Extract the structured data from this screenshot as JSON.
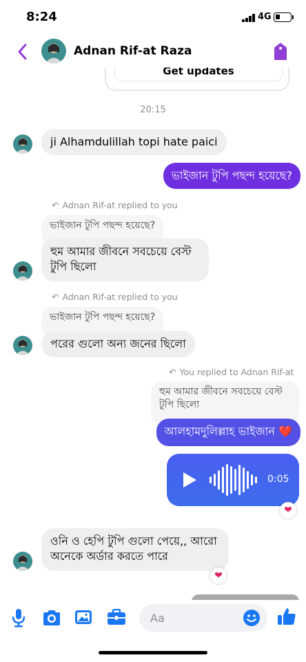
{
  "status_bar": {
    "time": "8:24",
    "network": "4G",
    "battery_level": 0.3
  },
  "header": {
    "contact_name": "Adnan Rif-at Raza"
  },
  "pinned": {
    "updates_text": "Get updates"
  },
  "timestamp": "20:15",
  "messages": [
    {
      "text": "ji Alhamdulillah topi hate paici"
    },
    {
      "text": "ভাইজান টুপি পছন্দ হয়েছে?"
    },
    {
      "reply_meta": "Adnan Rif-at replied to you",
      "quoted": "ভাইজান টুপি পছন্দ হয়েছে?",
      "line1": "হুম আমার জীবনে সবচেয়ে বেস্ট",
      "line2": "টুপি ছিলো"
    },
    {
      "reply_meta": "Adnan Rif-at replied to you",
      "quoted": "ভাইজান টুপি পছন্দ হয়েছে?",
      "text": "পরের গুলো অন্য জনের ছিলো"
    },
    {
      "reply_meta": "You replied to Adnan Rif-at",
      "quoted_line1": "হুম আমার জীবনে সবচেয়ে বেস্ট",
      "quoted_line2": "টুপি ছিলো",
      "text": "আলহামদুলিল্লাহ ভাইজান ❤️"
    },
    {
      "duration": "0:05",
      "reaction": "❤"
    },
    {
      "line1": "ওনি ও হেপি টুপি গুলো পেয়ে,, আরো",
      "line2": "অনেকে অর্ডার করতে পারে",
      "reaction": "❤"
    }
  ],
  "composer": {
    "placeholder": "Aa"
  },
  "colors": {
    "accent": "#6f2ee0",
    "audio_bubble": "#4262ee",
    "icon_blue": "#1a77f2",
    "header_purple": "#8f3fd6"
  }
}
